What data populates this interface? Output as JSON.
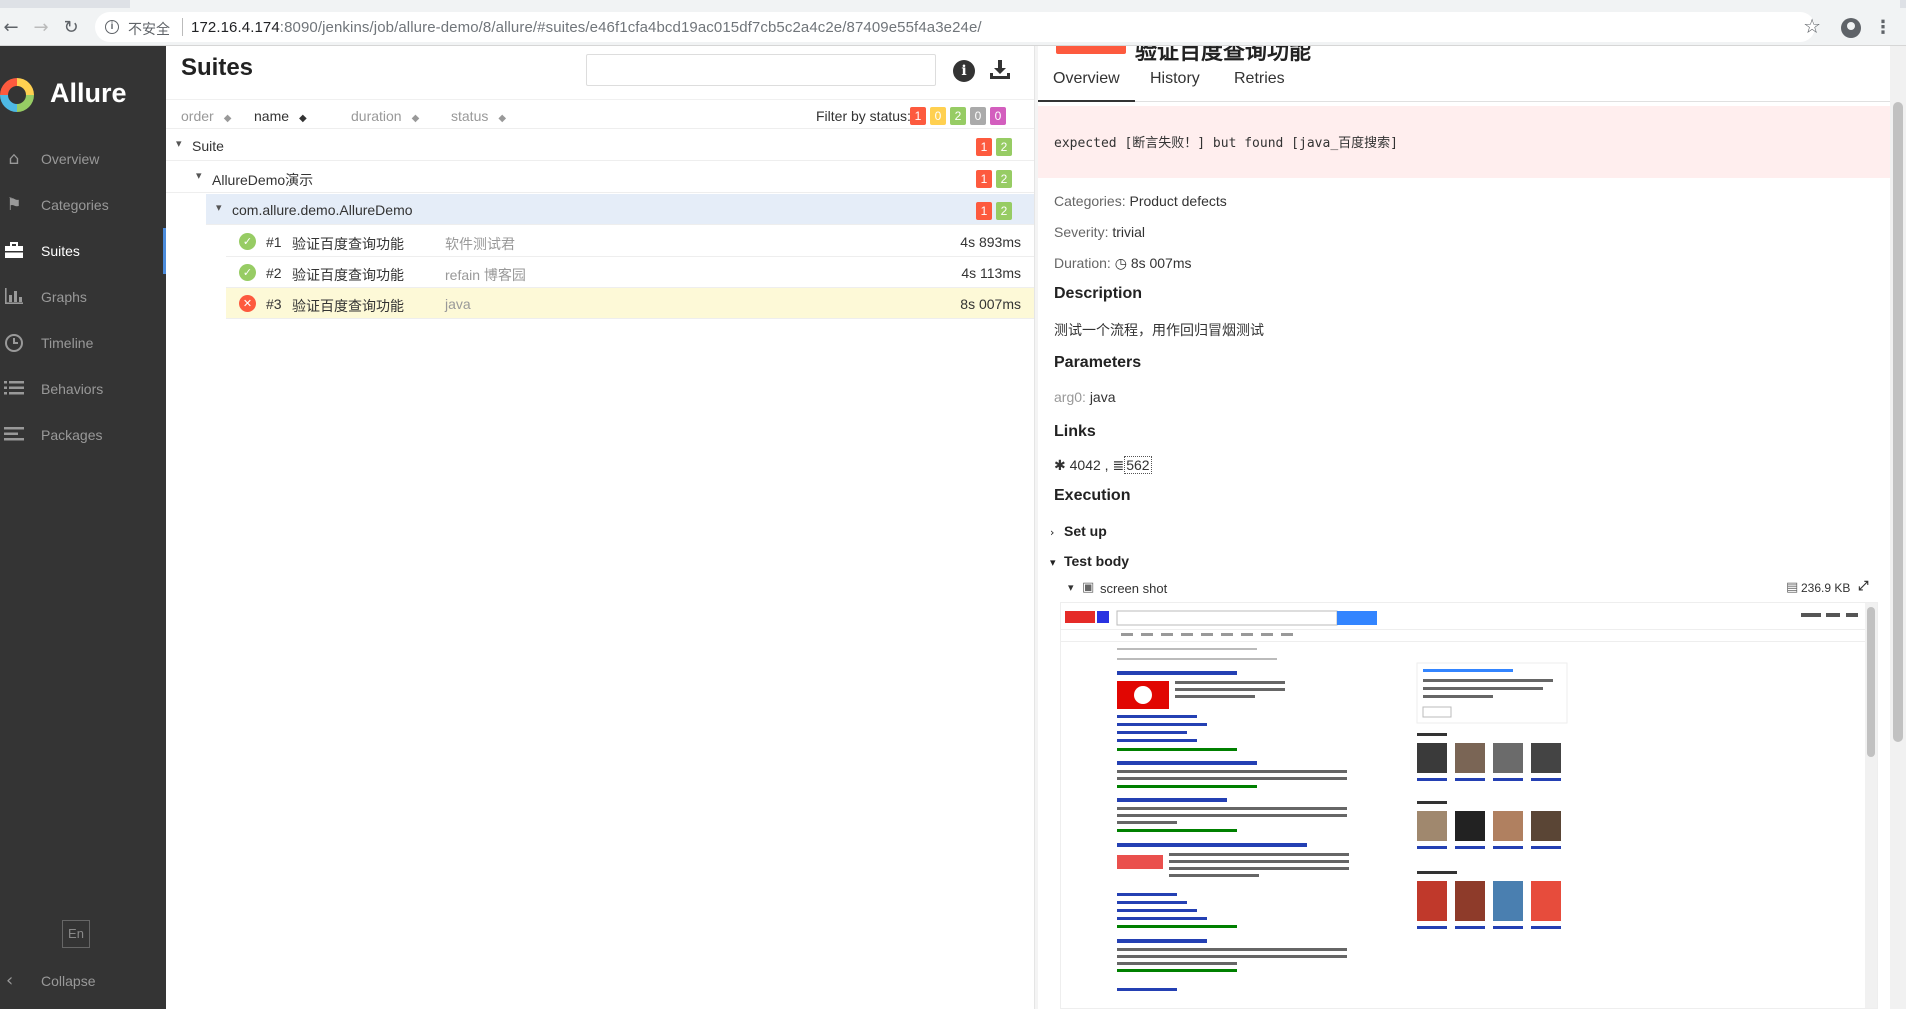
{
  "browser": {
    "insecure_label": "不安全",
    "url_host": "172.16.4.174",
    "url_rest": ":8090/jenkins/job/allure-demo/8/allure/#suites/e46f1cfa4bcd19ac015df7cb5c2a4c2e/87409e55f4a3e24e/"
  },
  "sidebar": {
    "brand": "Allure",
    "items": [
      {
        "label": "Overview",
        "icon": "home-icon"
      },
      {
        "label": "Categories",
        "icon": "flag-icon"
      },
      {
        "label": "Suites",
        "icon": "briefcase-icon",
        "active": true
      },
      {
        "label": "Graphs",
        "icon": "bar-chart-icon"
      },
      {
        "label": "Timeline",
        "icon": "clock-icon"
      },
      {
        "label": "Behaviors",
        "icon": "list-icon"
      },
      {
        "label": "Packages",
        "icon": "align-left-icon"
      }
    ],
    "lang": "En",
    "collapse": "Collapse"
  },
  "suites": {
    "title": "Suites",
    "search_placeholder": "",
    "sort": {
      "order": "order",
      "name": "name",
      "duration": "duration",
      "status": "status"
    },
    "filter_label": "Filter by status:",
    "filter_counts": [
      {
        "value": "1",
        "color": "#fd5a3e"
      },
      {
        "value": "0",
        "color": "#ffd050"
      },
      {
        "value": "2",
        "color": "#97cc64"
      },
      {
        "value": "0",
        "color": "#aaaaaa"
      },
      {
        "value": "0",
        "color": "#d35ebe"
      }
    ],
    "tree": [
      {
        "label": "Suite",
        "failed": "1",
        "passed": "2"
      },
      {
        "label": "AllureDemo演示",
        "failed": "1",
        "passed": "2"
      },
      {
        "label": "com.allure.demo.AllureDemo",
        "failed": "1",
        "passed": "2"
      }
    ],
    "tests": [
      {
        "num": "#1",
        "name": "验证百度查询功能",
        "desc": "软件测试君",
        "duration": "4s 893ms",
        "status": "passed"
      },
      {
        "num": "#2",
        "name": "验证百度查询功能",
        "desc": "refain 博客园",
        "duration": "4s 113ms",
        "status": "passed"
      },
      {
        "num": "#3",
        "name": "验证百度查询功能",
        "desc": "java",
        "duration": "8s 007ms",
        "status": "failed"
      }
    ]
  },
  "details": {
    "title": "验证百度查询功能",
    "tabs": [
      "Overview",
      "History",
      "Retries"
    ],
    "error": "expected [断言失败！] but found [java_百度搜索]",
    "categories_key": "Categories:",
    "categories_val": "Product defects",
    "severity_key": "Severity:",
    "severity_val": "trivial",
    "duration_key": "Duration:",
    "duration_val": "8s 007ms",
    "description_title": "Description",
    "description": "测试一个流程，用作回归冒烟测试",
    "parameters_title": "Parameters",
    "param_key": "arg0:",
    "param_val": "java",
    "links_title": "Links",
    "link_issue": "4042",
    "link_tms": "562",
    "execution_title": "Execution",
    "setup": "Set up",
    "testbody": "Test body",
    "attachment_name": "screen shot",
    "attachment_size": "236.9 KB"
  }
}
